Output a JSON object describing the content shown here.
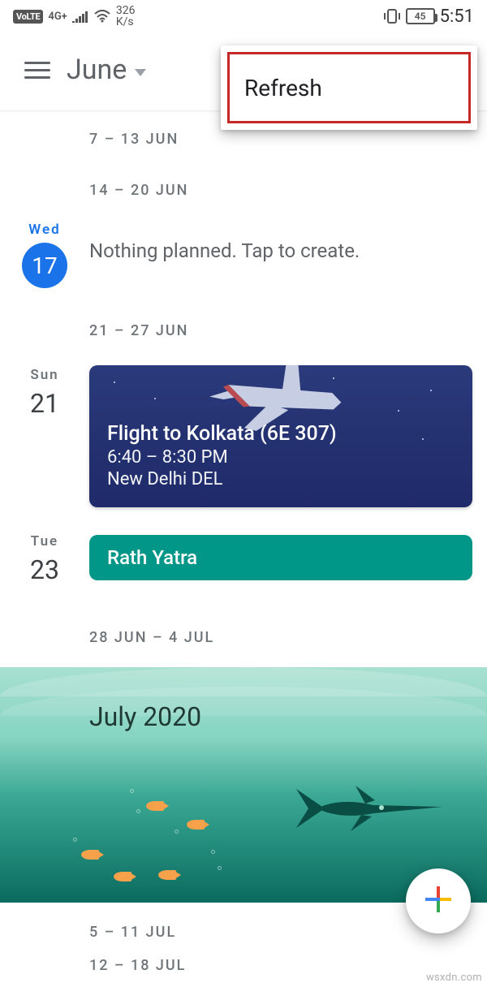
{
  "status": {
    "volte": "VoLTE",
    "net_gen": "4G+",
    "rate_top": "326",
    "rate_bottom": "K/s",
    "battery": "45",
    "clock": "5:51"
  },
  "header": {
    "month_label": "June"
  },
  "popup": {
    "refresh": "Refresh"
  },
  "weeks": {
    "w1": "7 – 13 Jun",
    "w2": "14 – 20 Jun",
    "w3": "21 – 27 Jun",
    "w4": "28 Jun – 4 Jul",
    "w5": "5 – 11 Jul",
    "w6": "12 – 18 Jul"
  },
  "today": {
    "dow": "Wed",
    "day": "17",
    "empty_text": "Nothing planned. Tap to create."
  },
  "day_sun": {
    "dow": "Sun",
    "day": "21"
  },
  "day_tue": {
    "dow": "Tue",
    "day": "23"
  },
  "flight": {
    "title": "Flight to Kolkata (6E 307)",
    "time": "6:40 – 8:30 PM",
    "origin": "New Delhi DEL"
  },
  "holiday": {
    "name": "Rath Yatra"
  },
  "month_banner": {
    "title": "July 2020"
  },
  "watermark": "wsxdn.com"
}
